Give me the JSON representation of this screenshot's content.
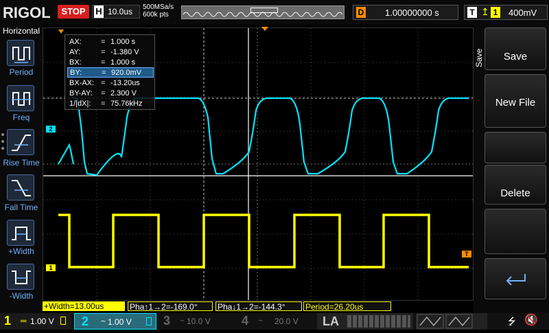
{
  "top": {
    "logo": "RIGOL",
    "run_state": "STOP",
    "horizontal_letter": "H",
    "timebase": "10.0us",
    "sample_rate": "500MSa/s",
    "memory_depth": "600k pts",
    "delay_letter": "D",
    "delay": "1.00000000 s",
    "trigger_letter": "T",
    "trigger_source": "1",
    "trigger_level": "400mV"
  },
  "left_menu": {
    "title": "Horizontal",
    "items": [
      {
        "label": "Period"
      },
      {
        "label": "Freq"
      },
      {
        "label": "Rise Time"
      },
      {
        "label": "Fall Time"
      },
      {
        "label": "+Width"
      },
      {
        "label": "-Width"
      }
    ]
  },
  "cursor_readout": {
    "rows": [
      {
        "key": "AX:",
        "value": "1.000 s"
      },
      {
        "key": "AY:",
        "value": "-1.380 V"
      },
      {
        "key": "BX:",
        "value": "1.000 s"
      },
      {
        "key": "BY:",
        "value": "920.0mV"
      },
      {
        "key": "BX-AX:",
        "value": "-13.20us"
      },
      {
        "key": "BY-AY:",
        "value": "2.300 V"
      },
      {
        "key": "1/|dX|:",
        "value": "75.76kHz"
      }
    ],
    "eq": "="
  },
  "right_menu": {
    "section": "Save",
    "buttons": [
      "Save",
      "New File",
      "Delete"
    ]
  },
  "measurements": {
    "width": "+Width=13.00us",
    "phase_rise": "Pha↑1→2=-169.0°",
    "phase_fall": "Pha↓1→2=-144.3°",
    "period": "Period=26.20us"
  },
  "channels": [
    {
      "num": "1",
      "scale": "1.00 V",
      "color": "#ffff00",
      "coupling": "DC",
      "active": true
    },
    {
      "num": "2",
      "scale": "1.00 V",
      "color": "#00e5ff",
      "coupling": "AC",
      "active": true
    },
    {
      "num": "3",
      "scale": "10.0 V",
      "color": "#666666",
      "coupling": "AC",
      "active": false
    },
    {
      "num": "4",
      "scale": "20.0 V",
      "color": "#666666",
      "coupling": "AC",
      "active": false
    }
  ],
  "la_label": "LA",
  "markers": {
    "ch1": "1",
    "ch2": "2",
    "trigger": "T"
  },
  "colors": {
    "ch1": "#ffff00",
    "ch2": "#00e5ff",
    "accent": "#6fb3ff",
    "stop": "#d81e1e",
    "delay": "#ff8c00"
  }
}
